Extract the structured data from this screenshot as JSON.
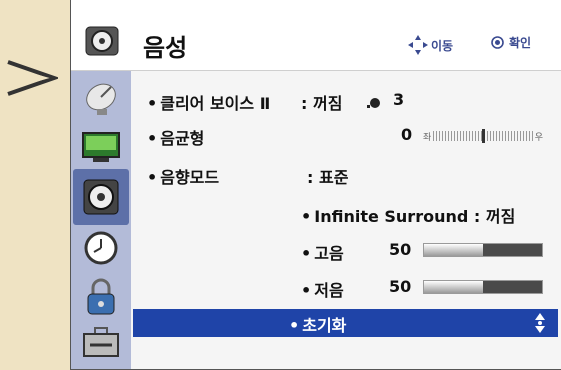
{
  "menu": {
    "title": "음성",
    "hint_move": "이동",
    "hint_ok": "확인"
  },
  "sidebar": {
    "items": [
      {
        "icon": "satellite-dish-icon"
      },
      {
        "icon": "monitor-icon"
      },
      {
        "icon": "speaker-icon",
        "active": true
      },
      {
        "icon": "clock-icon"
      },
      {
        "icon": "lock-icon"
      },
      {
        "icon": "toolbox-icon"
      }
    ]
  },
  "items": {
    "clear_voice": {
      "label": "클리어 보이스 Ⅱ",
      "value": ": 꺼짐",
      "level": "3"
    },
    "balance": {
      "label": "음균형",
      "value": "0",
      "left": "좌",
      "right": "우"
    },
    "sound_mode": {
      "label": "음향모드",
      "value": ": 표준"
    },
    "surround": {
      "label": "Infinite Surround",
      "value": ": 꺼짐"
    },
    "treble": {
      "label": "고음",
      "value": "50",
      "fraction": 0.5
    },
    "bass": {
      "label": "저음",
      "value": "50",
      "fraction": 0.5
    },
    "reset": {
      "label": "초기화",
      "selected": true
    }
  },
  "bullet": "•"
}
